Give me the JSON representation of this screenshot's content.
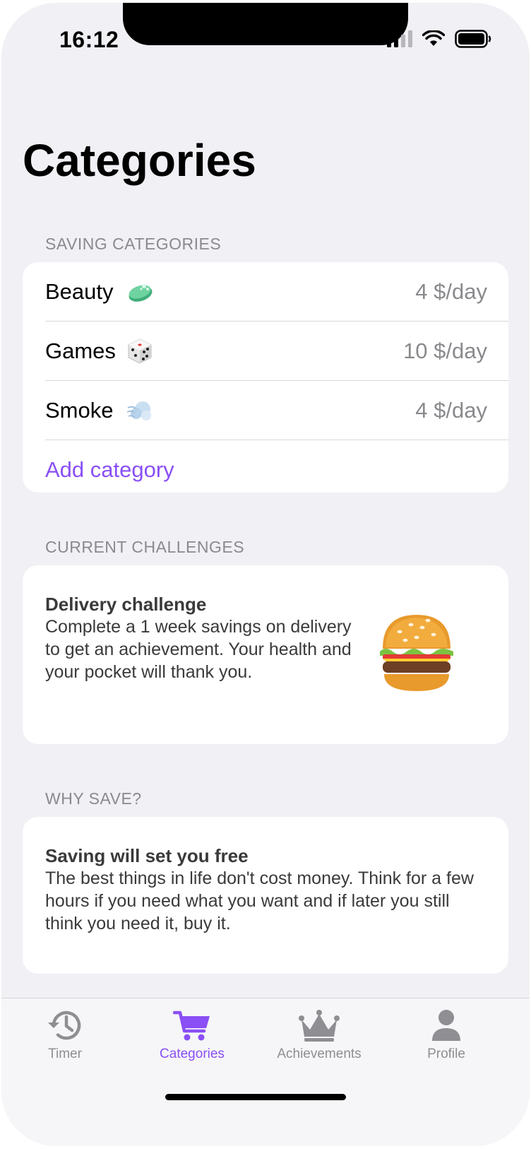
{
  "status_bar": {
    "time": "16:12"
  },
  "page": {
    "title": "Categories"
  },
  "sections": {
    "saving_categories": "SAVING CATEGORIES",
    "current_challenges": "CURRENT CHALLENGES",
    "why_save": "WHY SAVE?"
  },
  "categories": [
    {
      "name": "Beauty",
      "icon": "soap-icon",
      "value": "4 $/day"
    },
    {
      "name": "Games",
      "icon": "dice-icon",
      "value": "10 $/day"
    },
    {
      "name": "Smoke",
      "icon": "smoke-icon",
      "value": "4 $/day"
    }
  ],
  "add_category_label": "Add category",
  "challenge": {
    "title": "Delivery challenge",
    "body": "Complete a 1 week savings on delivery to get an achievement. Your health and your pocket will thank you.",
    "icon": "hamburger-icon"
  },
  "why_save": {
    "title": "Saving will set you free",
    "body": "The best things in life don't cost money. Think for a few hours if you need what you want and if later you still think you need it, buy it."
  },
  "tabs": [
    {
      "label": "Timer",
      "icon": "clock-history-icon",
      "active": false
    },
    {
      "label": "Categories",
      "icon": "cart-icon",
      "active": true
    },
    {
      "label": "Achievements",
      "icon": "crown-icon",
      "active": false
    },
    {
      "label": "Profile",
      "icon": "person-icon",
      "active": false
    }
  ],
  "colors": {
    "accent": "#8a4ff5",
    "background": "#f0f0f5",
    "secondary_text": "#8a8a8e"
  }
}
